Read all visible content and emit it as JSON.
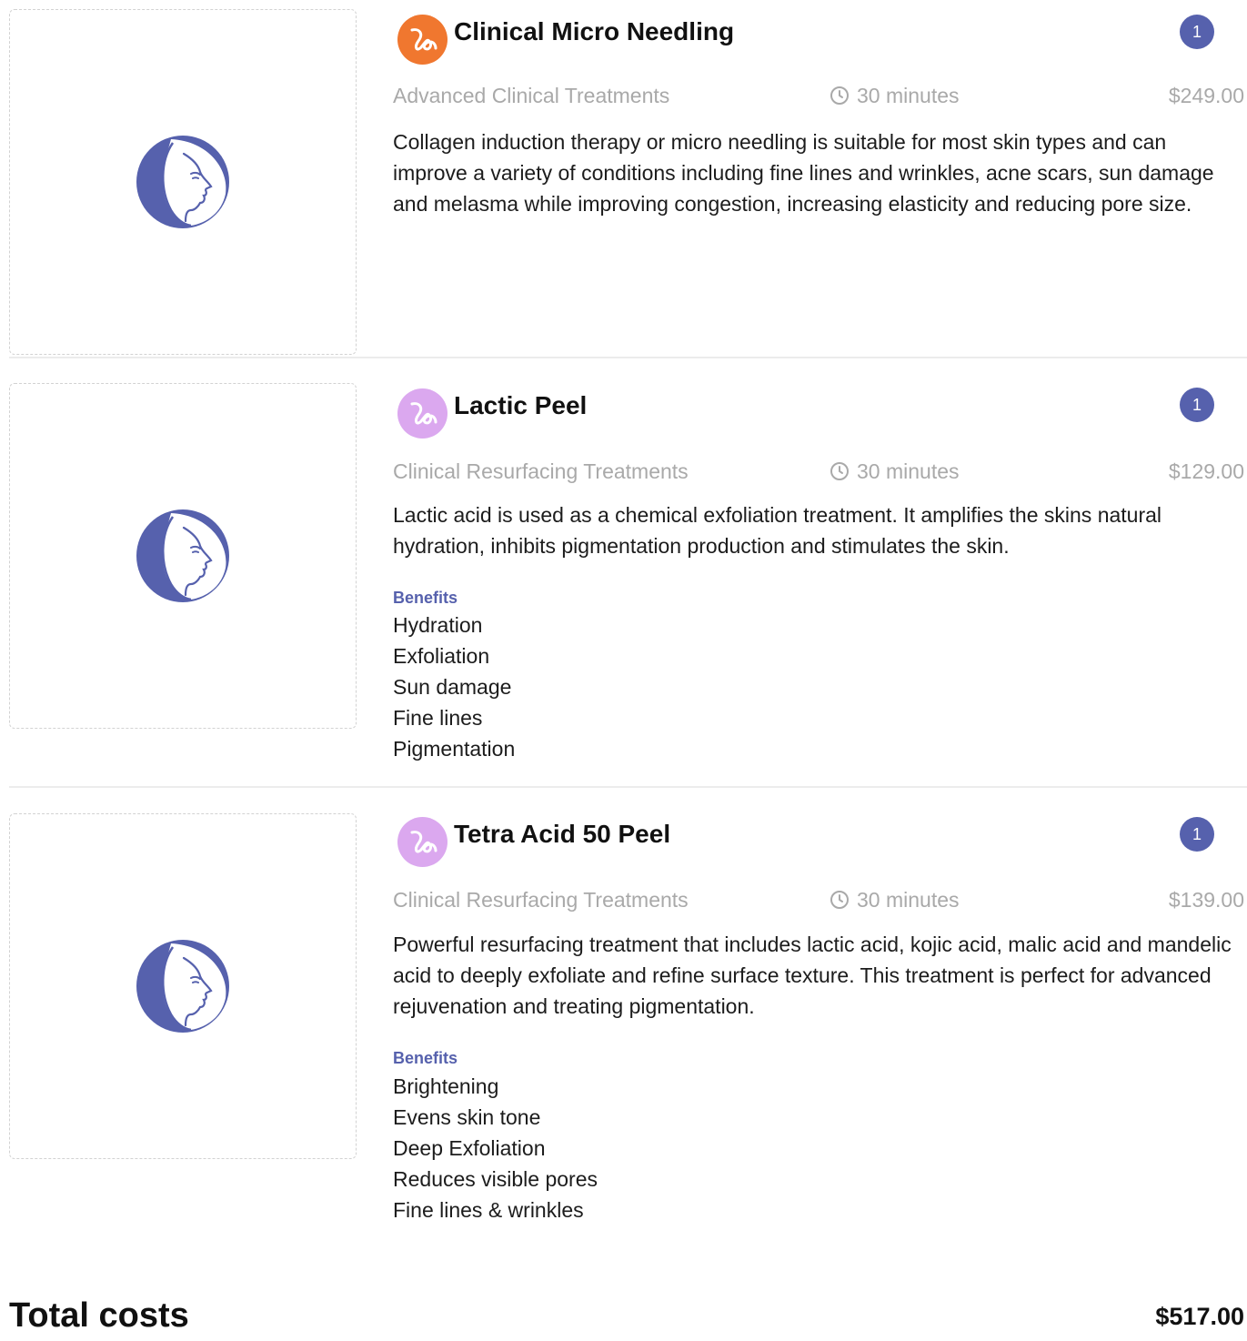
{
  "colors": {
    "accent": "#5661ad",
    "brand_orange": "#f0772f",
    "brand_lavender": "#dba8ef",
    "muted_text": "#a9a9a9",
    "divider": "#ececec"
  },
  "treatments": [
    {
      "title": "Clinical Micro Needling",
      "brand_icon": "brand-swirl-icon",
      "brand_color": "#f0772f",
      "quantity": "1",
      "category": "Advanced Clinical Treatments",
      "duration": "30 minutes",
      "price": "$249.00",
      "description": "Collagen induction therapy or micro needling is suitable for most skin types and can improve a variety of conditions including fine lines and wrinkles, acne scars, sun damage and melasma while improving congestion, increasing elasticity and reducing pore size.",
      "benefits_heading": "",
      "benefits": []
    },
    {
      "title": "Lactic Peel",
      "brand_icon": "brand-swirl-icon",
      "brand_color": "#dba8ef",
      "quantity": "1",
      "category": "Clinical Resurfacing Treatments",
      "duration": "30 minutes",
      "price": "$129.00",
      "description": "Lactic acid is used as a chemical exfoliation treatment. It amplifies the skins natural hydration, inhibits pigmentation production and stimulates the skin.",
      "benefits_heading": "Benefits",
      "benefits": [
        "Hydration",
        "Exfoliation",
        "Sun damage",
        "Fine lines",
        "Pigmentation"
      ]
    },
    {
      "title": "Tetra Acid 50 Peel",
      "brand_icon": "brand-swirl-icon",
      "brand_color": "#dba8ef",
      "quantity": "1",
      "category": "Clinical Resurfacing Treatments",
      "duration": "30 minutes",
      "price": "$139.00",
      "description": "Powerful resurfacing treatment that includes lactic acid, kojic acid, malic acid and mandelic acid to deeply exfoliate and refine surface texture. This treatment is perfect for advanced rejuvenation and treating pigmentation.",
      "benefits_heading": "Benefits",
      "benefits": [
        "Brightening",
        "Evens skin tone",
        "Deep Exfoliation",
        "Reduces visible pores",
        "Fine lines & wrinkles"
      ]
    }
  ],
  "total": {
    "label": "Total costs",
    "value": "$517.00"
  }
}
